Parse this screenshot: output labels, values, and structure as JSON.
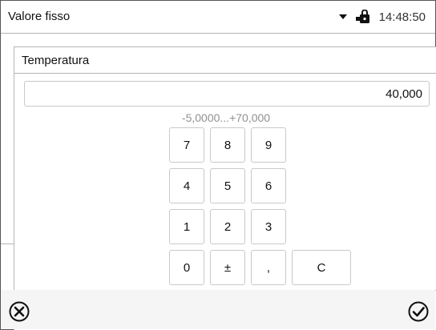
{
  "status_bar": {
    "title": "Valore fisso",
    "time": "14:48:50",
    "icons": [
      "dropdown-arrow-icon",
      "lock-icon"
    ]
  },
  "dialog": {
    "title": "Temperatura",
    "value": "40,000",
    "range_hint": "-5,0000...+70,000"
  },
  "keypad": {
    "rows": [
      [
        "7",
        "8",
        "9"
      ],
      [
        "4",
        "5",
        "6"
      ],
      [
        "1",
        "2",
        "3"
      ],
      [
        "0",
        "±",
        ",",
        "C"
      ]
    ]
  },
  "footer": {
    "icons": [
      "cancel-icon",
      "confirm-icon"
    ]
  }
}
